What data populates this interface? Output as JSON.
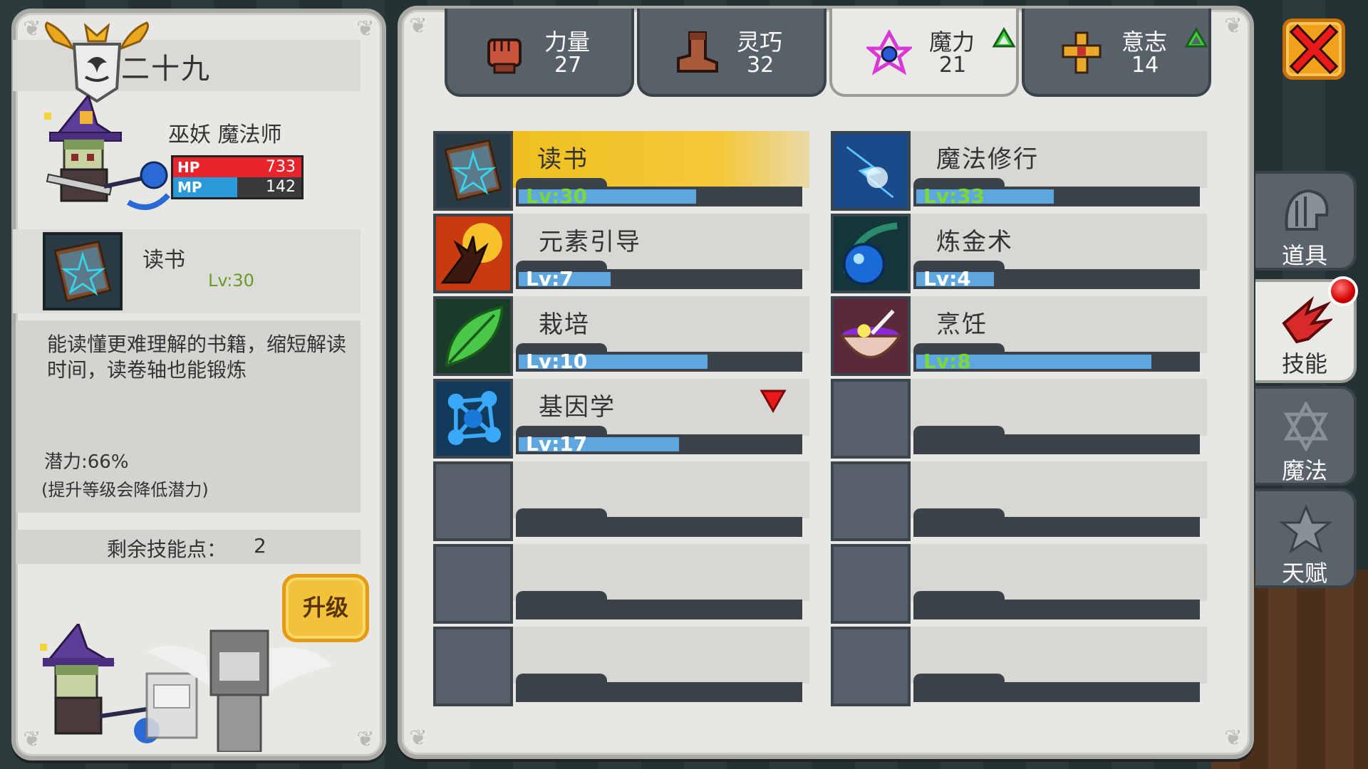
{
  "character": {
    "name": "二十九",
    "title": "巫妖  魔法师",
    "hp": {
      "label": "HP",
      "value": "733",
      "fraction": 1.0
    },
    "mp": {
      "label": "MP",
      "value": "142",
      "fraction": 0.5
    }
  },
  "selected_skill": {
    "name": "读书",
    "level": "Lv:30",
    "description": "能读懂更难理解的书籍，缩短解读时间，读卷轴也能锻炼",
    "potential": "潜力:66%",
    "potential_note": "(提升等级会降低潜力)"
  },
  "skill_points": {
    "label": "剩余技能点：",
    "value": "2"
  },
  "upgrade_button": "升级",
  "attributes": [
    {
      "label": "力量",
      "value": "27",
      "icon": "fist-icon",
      "active": false,
      "up": false
    },
    {
      "label": "灵巧",
      "value": "32",
      "icon": "boot-icon",
      "active": false,
      "up": false
    },
    {
      "label": "魔力",
      "value": "21",
      "icon": "magic-star-icon",
      "active": true,
      "up": true
    },
    {
      "label": "意志",
      "value": "14",
      "icon": "cross-shield-icon",
      "active": false,
      "up": true
    }
  ],
  "skills_left": [
    {
      "name": "读书",
      "level": "Lv:30",
      "progress": 0.64,
      "icon": "book-icon",
      "selected": true,
      "green": true
    },
    {
      "name": "元素引导",
      "level": "Lv:7",
      "progress": 0.34,
      "icon": "fire-hand-icon",
      "selected": false,
      "green": false
    },
    {
      "name": "栽培",
      "level": "Lv:10",
      "progress": 0.68,
      "icon": "leaf-icon",
      "selected": false,
      "green": false
    },
    {
      "name": "基因学",
      "level": "Lv:17",
      "progress": 0.58,
      "icon": "molecule-icon",
      "selected": false,
      "green": false,
      "marker": true
    }
  ],
  "skills_right": [
    {
      "name": "魔法修行",
      "level": "Lv:33",
      "progress": 0.5,
      "icon": "lightning-icon",
      "selected": false,
      "green": true
    },
    {
      "name": "炼金术",
      "level": "Lv:4",
      "progress": 0.29,
      "icon": "potion-icon",
      "selected": false,
      "green": false
    },
    {
      "name": "烹饪",
      "level": "Lv:8",
      "progress": 0.84,
      "icon": "bowl-icon",
      "selected": false,
      "green": true
    }
  ],
  "side_tabs": [
    {
      "label": "道具",
      "icon": "helmet-icon",
      "active": false
    },
    {
      "label": "技能",
      "icon": "claw-icon",
      "active": true,
      "notify": true
    },
    {
      "label": "魔法",
      "icon": "hexagram-icon",
      "active": false
    },
    {
      "label": "天赋",
      "icon": "star-icon",
      "active": false
    }
  ],
  "colors": {
    "hp": "#e8242c",
    "mp": "#2b9ad8",
    "level_bar": "#5ea6de",
    "level_text_green": "#7cd83a",
    "selected_band": "#f0c020",
    "close_button": "#f2a11a"
  }
}
